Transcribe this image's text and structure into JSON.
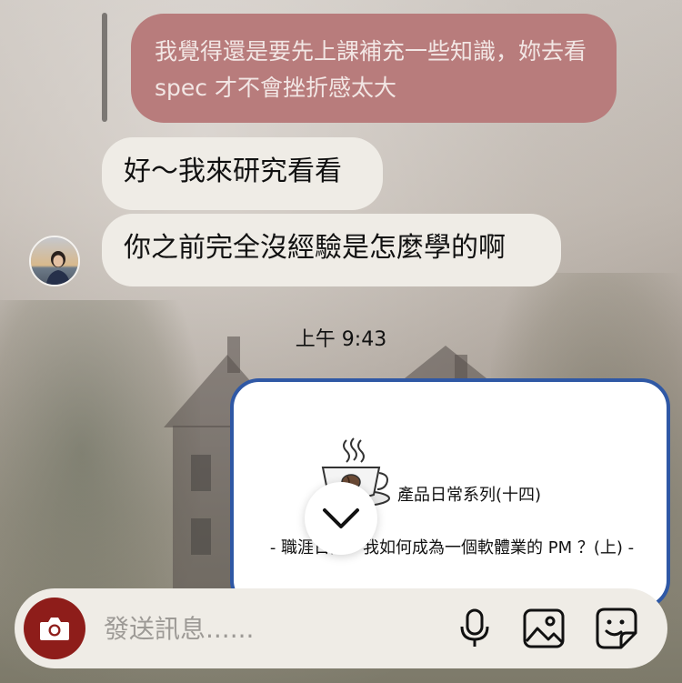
{
  "messages": {
    "quoted_reply": "我覺得還是要先上課補充一些知識，妳去看 spec 才不會挫折感太大",
    "incoming_1": "好～我來研究看看",
    "incoming_2": "你之前完全沒經驗是怎麼學的啊"
  },
  "timestamp": "上午 9:43",
  "shared_post": {
    "title": "產品日常系列(十四)",
    "subtitle": "- 職涯日記：我如何成為一個軟體業的 PM ？(上) -",
    "icon": "coffee-cup-icon"
  },
  "composer": {
    "placeholder": "發送訊息......",
    "icons": [
      "camera-icon",
      "microphone-icon",
      "image-icon",
      "sticker-icon"
    ]
  },
  "colors": {
    "quoted_bubble": "#b87c7c",
    "incoming_bubble": "#efece6",
    "camera_button": "#8e1d1a",
    "card_border": "#2f58a5"
  }
}
